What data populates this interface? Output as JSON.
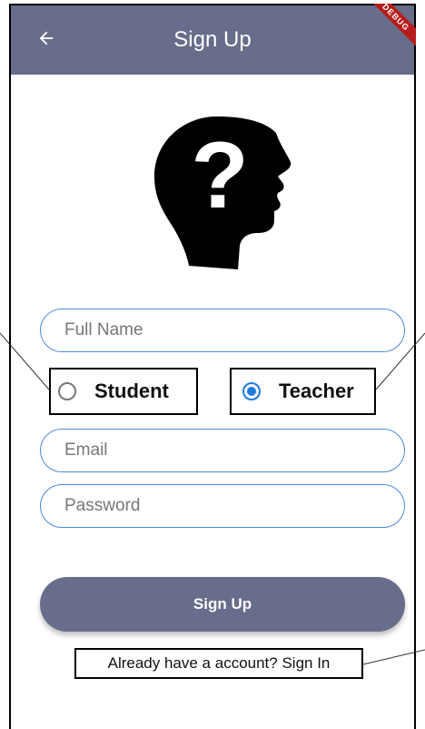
{
  "app_bar": {
    "title": "Sign Up",
    "back_icon": "arrow-left-icon",
    "debug_banner": "DEBUG",
    "color": "#676d8a"
  },
  "avatar": {
    "icon": "question-head-icon"
  },
  "form": {
    "full_name_placeholder": "Full Name",
    "email_placeholder": "Email",
    "password_placeholder": "Password",
    "accent_color": "#4d88dd"
  },
  "role": {
    "options": [
      {
        "label": "Student",
        "selected": false
      },
      {
        "label": "Teacher",
        "selected": true
      }
    ],
    "selected_color": "#1e7be0"
  },
  "actions": {
    "sign_up_label": "Sign Up",
    "sign_in_prompt": "Already have a account? Sign In"
  }
}
